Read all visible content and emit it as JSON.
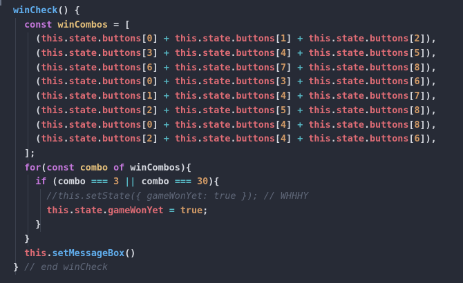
{
  "editor": {
    "colors": {
      "background": "#272b36",
      "keyword": "#c678dd",
      "function": "#61afef",
      "variable": "#e5c07b",
      "property": "#e06c75",
      "number": "#d19a66",
      "operator": "#56b6c2",
      "comment": "#5f6778",
      "text": "#d5d8df"
    },
    "lines": [
      [
        {
          "t": "winCheck",
          "c": "fn"
        },
        {
          "t": "() {",
          "c": "punc"
        }
      ],
      [
        {
          "t": "  ",
          "c": "plain"
        },
        {
          "t": "const",
          "c": "kw"
        },
        {
          "t": " ",
          "c": "plain"
        },
        {
          "t": "winCombos",
          "c": "var"
        },
        {
          "t": " = [",
          "c": "punc"
        }
      ],
      [
        {
          "t": "    (",
          "c": "punc"
        },
        {
          "t": "this",
          "c": "this"
        },
        {
          "t": ".",
          "c": "punc"
        },
        {
          "t": "state",
          "c": "prop"
        },
        {
          "t": ".",
          "c": "punc"
        },
        {
          "t": "buttons",
          "c": "prop"
        },
        {
          "t": "[",
          "c": "punc"
        },
        {
          "t": "0",
          "c": "num"
        },
        {
          "t": "] ",
          "c": "punc"
        },
        {
          "t": "+",
          "c": "op"
        },
        {
          "t": " ",
          "c": "plain"
        },
        {
          "t": "this",
          "c": "this"
        },
        {
          "t": ".",
          "c": "punc"
        },
        {
          "t": "state",
          "c": "prop"
        },
        {
          "t": ".",
          "c": "punc"
        },
        {
          "t": "buttons",
          "c": "prop"
        },
        {
          "t": "[",
          "c": "punc"
        },
        {
          "t": "1",
          "c": "num"
        },
        {
          "t": "] ",
          "c": "punc"
        },
        {
          "t": "+",
          "c": "op"
        },
        {
          "t": " ",
          "c": "plain"
        },
        {
          "t": "this",
          "c": "this"
        },
        {
          "t": ".",
          "c": "punc"
        },
        {
          "t": "state",
          "c": "prop"
        },
        {
          "t": ".",
          "c": "punc"
        },
        {
          "t": "buttons",
          "c": "prop"
        },
        {
          "t": "[",
          "c": "punc"
        },
        {
          "t": "2",
          "c": "num"
        },
        {
          "t": "]),",
          "c": "punc"
        }
      ],
      [
        {
          "t": "    (",
          "c": "punc"
        },
        {
          "t": "this",
          "c": "this"
        },
        {
          "t": ".",
          "c": "punc"
        },
        {
          "t": "state",
          "c": "prop"
        },
        {
          "t": ".",
          "c": "punc"
        },
        {
          "t": "buttons",
          "c": "prop"
        },
        {
          "t": "[",
          "c": "punc"
        },
        {
          "t": "3",
          "c": "num"
        },
        {
          "t": "] ",
          "c": "punc"
        },
        {
          "t": "+",
          "c": "op"
        },
        {
          "t": " ",
          "c": "plain"
        },
        {
          "t": "this",
          "c": "this"
        },
        {
          "t": ".",
          "c": "punc"
        },
        {
          "t": "state",
          "c": "prop"
        },
        {
          "t": ".",
          "c": "punc"
        },
        {
          "t": "buttons",
          "c": "prop"
        },
        {
          "t": "[",
          "c": "punc"
        },
        {
          "t": "4",
          "c": "num"
        },
        {
          "t": "] ",
          "c": "punc"
        },
        {
          "t": "+",
          "c": "op"
        },
        {
          "t": " ",
          "c": "plain"
        },
        {
          "t": "this",
          "c": "this"
        },
        {
          "t": ".",
          "c": "punc"
        },
        {
          "t": "state",
          "c": "prop"
        },
        {
          "t": ".",
          "c": "punc"
        },
        {
          "t": "buttons",
          "c": "prop"
        },
        {
          "t": "[",
          "c": "punc"
        },
        {
          "t": "5",
          "c": "num"
        },
        {
          "t": "]),",
          "c": "punc"
        }
      ],
      [
        {
          "t": "    (",
          "c": "punc"
        },
        {
          "t": "this",
          "c": "this"
        },
        {
          "t": ".",
          "c": "punc"
        },
        {
          "t": "state",
          "c": "prop"
        },
        {
          "t": ".",
          "c": "punc"
        },
        {
          "t": "buttons",
          "c": "prop"
        },
        {
          "t": "[",
          "c": "punc"
        },
        {
          "t": "6",
          "c": "num"
        },
        {
          "t": "] ",
          "c": "punc"
        },
        {
          "t": "+",
          "c": "op"
        },
        {
          "t": " ",
          "c": "plain"
        },
        {
          "t": "this",
          "c": "this"
        },
        {
          "t": ".",
          "c": "punc"
        },
        {
          "t": "state",
          "c": "prop"
        },
        {
          "t": ".",
          "c": "punc"
        },
        {
          "t": "buttons",
          "c": "prop"
        },
        {
          "t": "[",
          "c": "punc"
        },
        {
          "t": "7",
          "c": "num"
        },
        {
          "t": "] ",
          "c": "punc"
        },
        {
          "t": "+",
          "c": "op"
        },
        {
          "t": " ",
          "c": "plain"
        },
        {
          "t": "this",
          "c": "this"
        },
        {
          "t": ".",
          "c": "punc"
        },
        {
          "t": "state",
          "c": "prop"
        },
        {
          "t": ".",
          "c": "punc"
        },
        {
          "t": "buttons",
          "c": "prop"
        },
        {
          "t": "[",
          "c": "punc"
        },
        {
          "t": "8",
          "c": "num"
        },
        {
          "t": "]),",
          "c": "punc"
        }
      ],
      [
        {
          "t": "    (",
          "c": "punc"
        },
        {
          "t": "this",
          "c": "this"
        },
        {
          "t": ".",
          "c": "punc"
        },
        {
          "t": "state",
          "c": "prop"
        },
        {
          "t": ".",
          "c": "punc"
        },
        {
          "t": "buttons",
          "c": "prop"
        },
        {
          "t": "[",
          "c": "punc"
        },
        {
          "t": "0",
          "c": "num"
        },
        {
          "t": "] ",
          "c": "punc"
        },
        {
          "t": "+",
          "c": "op"
        },
        {
          "t": " ",
          "c": "plain"
        },
        {
          "t": "this",
          "c": "this"
        },
        {
          "t": ".",
          "c": "punc"
        },
        {
          "t": "state",
          "c": "prop"
        },
        {
          "t": ".",
          "c": "punc"
        },
        {
          "t": "buttons",
          "c": "prop"
        },
        {
          "t": "[",
          "c": "punc"
        },
        {
          "t": "3",
          "c": "num"
        },
        {
          "t": "] ",
          "c": "punc"
        },
        {
          "t": "+",
          "c": "op"
        },
        {
          "t": " ",
          "c": "plain"
        },
        {
          "t": "this",
          "c": "this"
        },
        {
          "t": ".",
          "c": "punc"
        },
        {
          "t": "state",
          "c": "prop"
        },
        {
          "t": ".",
          "c": "punc"
        },
        {
          "t": "buttons",
          "c": "prop"
        },
        {
          "t": "[",
          "c": "punc"
        },
        {
          "t": "6",
          "c": "num"
        },
        {
          "t": "]),",
          "c": "punc"
        }
      ],
      [
        {
          "t": "    (",
          "c": "punc"
        },
        {
          "t": "this",
          "c": "this"
        },
        {
          "t": ".",
          "c": "punc"
        },
        {
          "t": "state",
          "c": "prop"
        },
        {
          "t": ".",
          "c": "punc"
        },
        {
          "t": "buttons",
          "c": "prop"
        },
        {
          "t": "[",
          "c": "punc"
        },
        {
          "t": "1",
          "c": "num"
        },
        {
          "t": "] ",
          "c": "punc"
        },
        {
          "t": "+",
          "c": "op"
        },
        {
          "t": " ",
          "c": "plain"
        },
        {
          "t": "this",
          "c": "this"
        },
        {
          "t": ".",
          "c": "punc"
        },
        {
          "t": "state",
          "c": "prop"
        },
        {
          "t": ".",
          "c": "punc"
        },
        {
          "t": "buttons",
          "c": "prop"
        },
        {
          "t": "[",
          "c": "punc"
        },
        {
          "t": "4",
          "c": "num"
        },
        {
          "t": "] ",
          "c": "punc"
        },
        {
          "t": "+",
          "c": "op"
        },
        {
          "t": " ",
          "c": "plain"
        },
        {
          "t": "this",
          "c": "this"
        },
        {
          "t": ".",
          "c": "punc"
        },
        {
          "t": "state",
          "c": "prop"
        },
        {
          "t": ".",
          "c": "punc"
        },
        {
          "t": "buttons",
          "c": "prop"
        },
        {
          "t": "[",
          "c": "punc"
        },
        {
          "t": "7",
          "c": "num"
        },
        {
          "t": "]),",
          "c": "punc"
        }
      ],
      [
        {
          "t": "    (",
          "c": "punc"
        },
        {
          "t": "this",
          "c": "this"
        },
        {
          "t": ".",
          "c": "punc"
        },
        {
          "t": "state",
          "c": "prop"
        },
        {
          "t": ".",
          "c": "punc"
        },
        {
          "t": "buttons",
          "c": "prop"
        },
        {
          "t": "[",
          "c": "punc"
        },
        {
          "t": "2",
          "c": "num"
        },
        {
          "t": "] ",
          "c": "punc"
        },
        {
          "t": "+",
          "c": "op"
        },
        {
          "t": " ",
          "c": "plain"
        },
        {
          "t": "this",
          "c": "this"
        },
        {
          "t": ".",
          "c": "punc"
        },
        {
          "t": "state",
          "c": "prop"
        },
        {
          "t": ".",
          "c": "punc"
        },
        {
          "t": "buttons",
          "c": "prop"
        },
        {
          "t": "[",
          "c": "punc"
        },
        {
          "t": "5",
          "c": "num"
        },
        {
          "t": "] ",
          "c": "punc"
        },
        {
          "t": "+",
          "c": "op"
        },
        {
          "t": " ",
          "c": "plain"
        },
        {
          "t": "this",
          "c": "this"
        },
        {
          "t": ".",
          "c": "punc"
        },
        {
          "t": "state",
          "c": "prop"
        },
        {
          "t": ".",
          "c": "punc"
        },
        {
          "t": "buttons",
          "c": "prop"
        },
        {
          "t": "[",
          "c": "punc"
        },
        {
          "t": "8",
          "c": "num"
        },
        {
          "t": "]),",
          "c": "punc"
        }
      ],
      [
        {
          "t": "    (",
          "c": "punc"
        },
        {
          "t": "this",
          "c": "this"
        },
        {
          "t": ".",
          "c": "punc"
        },
        {
          "t": "state",
          "c": "prop"
        },
        {
          "t": ".",
          "c": "punc"
        },
        {
          "t": "buttons",
          "c": "prop"
        },
        {
          "t": "[",
          "c": "punc"
        },
        {
          "t": "0",
          "c": "num"
        },
        {
          "t": "] ",
          "c": "punc"
        },
        {
          "t": "+",
          "c": "op"
        },
        {
          "t": " ",
          "c": "plain"
        },
        {
          "t": "this",
          "c": "this"
        },
        {
          "t": ".",
          "c": "punc"
        },
        {
          "t": "state",
          "c": "prop"
        },
        {
          "t": ".",
          "c": "punc"
        },
        {
          "t": "buttons",
          "c": "prop"
        },
        {
          "t": "[",
          "c": "punc"
        },
        {
          "t": "4",
          "c": "num"
        },
        {
          "t": "] ",
          "c": "punc"
        },
        {
          "t": "+",
          "c": "op"
        },
        {
          "t": " ",
          "c": "plain"
        },
        {
          "t": "this",
          "c": "this"
        },
        {
          "t": ".",
          "c": "punc"
        },
        {
          "t": "state",
          "c": "prop"
        },
        {
          "t": ".",
          "c": "punc"
        },
        {
          "t": "buttons",
          "c": "prop"
        },
        {
          "t": "[",
          "c": "punc"
        },
        {
          "t": "8",
          "c": "num"
        },
        {
          "t": "]),",
          "c": "punc"
        }
      ],
      [
        {
          "t": "    (",
          "c": "punc"
        },
        {
          "t": "this",
          "c": "this"
        },
        {
          "t": ".",
          "c": "punc"
        },
        {
          "t": "state",
          "c": "prop"
        },
        {
          "t": ".",
          "c": "punc"
        },
        {
          "t": "buttons",
          "c": "prop"
        },
        {
          "t": "[",
          "c": "punc"
        },
        {
          "t": "2",
          "c": "num"
        },
        {
          "t": "] ",
          "c": "punc"
        },
        {
          "t": "+",
          "c": "op"
        },
        {
          "t": " ",
          "c": "plain"
        },
        {
          "t": "this",
          "c": "this"
        },
        {
          "t": ".",
          "c": "punc"
        },
        {
          "t": "state",
          "c": "prop"
        },
        {
          "t": ".",
          "c": "punc"
        },
        {
          "t": "buttons",
          "c": "prop"
        },
        {
          "t": "[",
          "c": "punc"
        },
        {
          "t": "4",
          "c": "num"
        },
        {
          "t": "] ",
          "c": "punc"
        },
        {
          "t": "+",
          "c": "op"
        },
        {
          "t": " ",
          "c": "plain"
        },
        {
          "t": "this",
          "c": "this"
        },
        {
          "t": ".",
          "c": "punc"
        },
        {
          "t": "state",
          "c": "prop"
        },
        {
          "t": ".",
          "c": "punc"
        },
        {
          "t": "buttons",
          "c": "prop"
        },
        {
          "t": "[",
          "c": "punc"
        },
        {
          "t": "6",
          "c": "num"
        },
        {
          "t": "]),",
          "c": "punc"
        }
      ],
      [
        {
          "t": "  ];",
          "c": "punc"
        }
      ],
      [
        {
          "t": "  ",
          "c": "plain"
        },
        {
          "t": "for",
          "c": "kw"
        },
        {
          "t": "(",
          "c": "punc"
        },
        {
          "t": "const",
          "c": "kw"
        },
        {
          "t": " ",
          "c": "plain"
        },
        {
          "t": "combo",
          "c": "var"
        },
        {
          "t": " ",
          "c": "plain"
        },
        {
          "t": "of",
          "c": "kw"
        },
        {
          "t": " ",
          "c": "plain"
        },
        {
          "t": "winCombos",
          "c": "plain"
        },
        {
          "t": "){",
          "c": "punc"
        }
      ],
      [
        {
          "t": "    ",
          "c": "plain"
        },
        {
          "t": "if",
          "c": "kw"
        },
        {
          "t": " (",
          "c": "punc"
        },
        {
          "t": "combo",
          "c": "plain"
        },
        {
          "t": " ",
          "c": "plain"
        },
        {
          "t": "===",
          "c": "op"
        },
        {
          "t": " ",
          "c": "plain"
        },
        {
          "t": "3",
          "c": "num"
        },
        {
          "t": " ",
          "c": "plain"
        },
        {
          "t": "||",
          "c": "op"
        },
        {
          "t": " ",
          "c": "plain"
        },
        {
          "t": "combo",
          "c": "plain"
        },
        {
          "t": " ",
          "c": "plain"
        },
        {
          "t": "===",
          "c": "op"
        },
        {
          "t": " ",
          "c": "plain"
        },
        {
          "t": "30",
          "c": "num"
        },
        {
          "t": "){",
          "c": "punc"
        }
      ],
      [
        {
          "t": "      ",
          "c": "plain"
        },
        {
          "t": "//this.setState({ gameWonYet: true }); // WHHHY",
          "c": "comment"
        }
      ],
      [
        {
          "t": "      ",
          "c": "plain"
        },
        {
          "t": "this",
          "c": "this"
        },
        {
          "t": ".",
          "c": "punc"
        },
        {
          "t": "state",
          "c": "prop"
        },
        {
          "t": ".",
          "c": "punc"
        },
        {
          "t": "gameWonYet",
          "c": "prop"
        },
        {
          "t": " ",
          "c": "plain"
        },
        {
          "t": "=",
          "c": "op"
        },
        {
          "t": " ",
          "c": "plain"
        },
        {
          "t": "true",
          "c": "bool"
        },
        {
          "t": ";",
          "c": "punc"
        }
      ],
      [
        {
          "t": "    }",
          "c": "punc"
        }
      ],
      [
        {
          "t": "  }",
          "c": "punc"
        }
      ],
      [
        {
          "t": "  ",
          "c": "plain"
        },
        {
          "t": "this",
          "c": "this"
        },
        {
          "t": ".",
          "c": "punc"
        },
        {
          "t": "setMessageBox",
          "c": "fn"
        },
        {
          "t": "()",
          "c": "punc"
        }
      ],
      [
        {
          "t": "} ",
          "c": "punc"
        },
        {
          "t": "// end winCheck",
          "c": "comment"
        }
      ]
    ]
  }
}
